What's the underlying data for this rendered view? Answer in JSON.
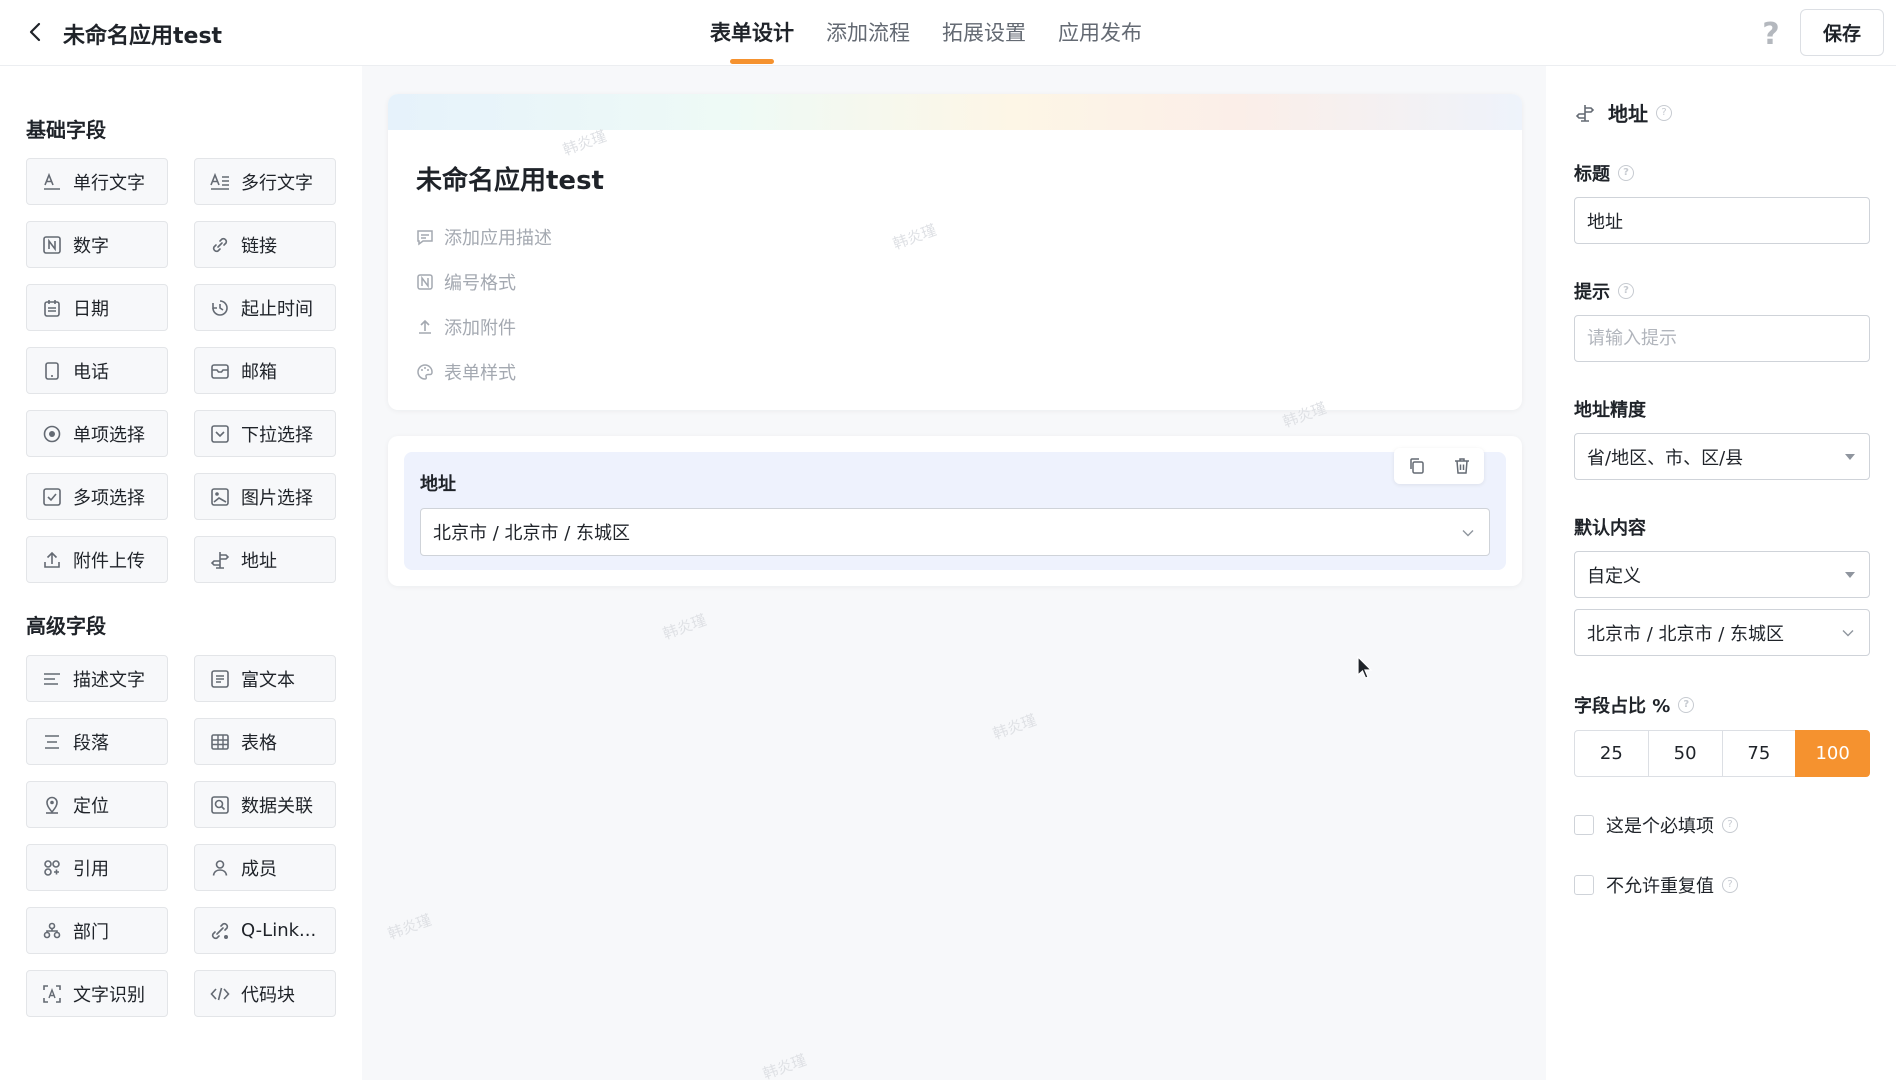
{
  "header": {
    "app_title": "未命名应用test",
    "tabs": [
      "表单设计",
      "添加流程",
      "拓展设置",
      "应用发布"
    ],
    "save_label": "保存"
  },
  "palette": {
    "basic_title": "基础字段",
    "basic": [
      {
        "label": "单行文字",
        "icon": "text-icon"
      },
      {
        "label": "多行文字",
        "icon": "multiline-text-icon"
      },
      {
        "label": "数字",
        "icon": "number-icon"
      },
      {
        "label": "链接",
        "icon": "link-icon"
      },
      {
        "label": "日期",
        "icon": "calendar-icon"
      },
      {
        "label": "起止时间",
        "icon": "time-range-icon"
      },
      {
        "label": "电话",
        "icon": "phone-icon"
      },
      {
        "label": "邮箱",
        "icon": "mail-icon"
      },
      {
        "label": "单项选择",
        "icon": "radio-icon"
      },
      {
        "label": "下拉选择",
        "icon": "dropdown-icon"
      },
      {
        "label": "多项选择",
        "icon": "checkbox-icon"
      },
      {
        "label": "图片选择",
        "icon": "image-icon"
      },
      {
        "label": "附件上传",
        "icon": "upload-icon"
      },
      {
        "label": "地址",
        "icon": "signpost-icon"
      }
    ],
    "advanced_title": "高级字段",
    "advanced": [
      {
        "label": "描述文字",
        "icon": "description-icon"
      },
      {
        "label": "富文本",
        "icon": "richtext-icon"
      },
      {
        "label": "段落",
        "icon": "paragraph-icon"
      },
      {
        "label": "表格",
        "icon": "table-icon"
      },
      {
        "label": "定位",
        "icon": "location-icon"
      },
      {
        "label": "数据关联",
        "icon": "data-link-icon"
      },
      {
        "label": "引用",
        "icon": "reference-icon"
      },
      {
        "label": "成员",
        "icon": "user-icon"
      },
      {
        "label": "部门",
        "icon": "department-icon"
      },
      {
        "label": "Q-Link...",
        "icon": "qlink-icon"
      },
      {
        "label": "文字识别",
        "icon": "ocr-icon"
      },
      {
        "label": "代码块",
        "icon": "code-icon"
      }
    ]
  },
  "form": {
    "title": "未命名应用test",
    "meta": [
      {
        "label": "添加应用描述",
        "icon": "comment-icon"
      },
      {
        "label": "编号格式",
        "icon": "number-format-icon"
      },
      {
        "label": "添加附件",
        "icon": "upload-icon"
      },
      {
        "label": "表单样式",
        "icon": "palette-icon"
      }
    ],
    "field": {
      "label": "地址",
      "value": "北京市 / 北京市 / 东城区"
    },
    "watermark": "韩炎瑾"
  },
  "props": {
    "header": "地址",
    "title_label": "标题",
    "title_value": "地址",
    "hint_label": "提示",
    "hint_placeholder": "请输入提示",
    "precision_label": "地址精度",
    "precision_value": "省/地区、市、区/县",
    "default_label": "默认内容",
    "default_mode": "自定义",
    "default_value": "北京市 / 北京市 / 东城区",
    "ratio_label": "字段占比 %",
    "ratio_options": [
      "25",
      "50",
      "75",
      "100"
    ],
    "ratio_selected": "100",
    "required_label": "这是个必填项",
    "unique_label": "不允许重复值"
  },
  "colors": {
    "accent": "#f5922f",
    "field_bg": "#eef2fd"
  }
}
